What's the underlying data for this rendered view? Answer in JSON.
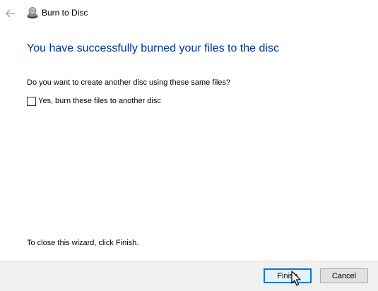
{
  "window": {
    "title": "Burn to Disc"
  },
  "icons": {
    "back": "arrow-left-icon",
    "app": "disc-burn-icon",
    "cursor": "mouse-pointer-icon"
  },
  "content": {
    "heading": "You have successfully burned your files to the disc",
    "question": "Do you want to create another disc using these same files?",
    "checkbox_label": "Yes, burn these files to another disc",
    "checkbox_checked": false,
    "close_hint": "To close this wizard, click Finish."
  },
  "buttons": {
    "finish_label": "Finish",
    "cancel_label": "Cancel"
  },
  "colors": {
    "heading": "#003399",
    "footer_bg": "#f0f0f0",
    "focus_border": "#0078d7",
    "focus_bg": "#e5f1fb"
  }
}
